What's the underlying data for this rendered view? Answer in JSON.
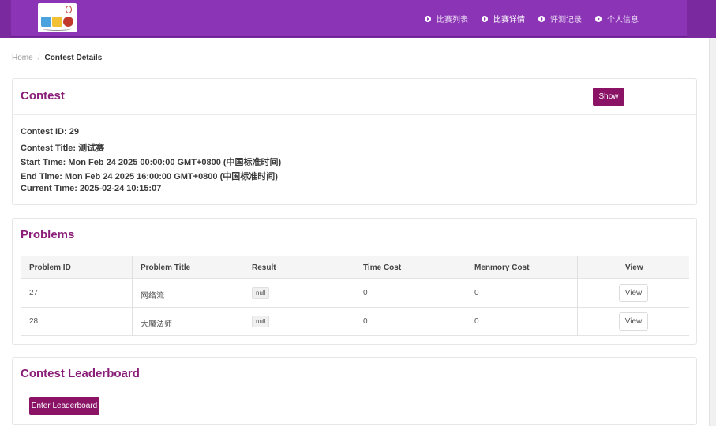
{
  "nav": {
    "items": [
      {
        "label": "比赛列表"
      },
      {
        "label": "比赛详情"
      },
      {
        "label": "评测记录"
      },
      {
        "label": "个人信息"
      }
    ]
  },
  "breadcrumb": {
    "home": "Home",
    "separator": "/",
    "current": "Contest Details"
  },
  "contest": {
    "title": "Contest",
    "show_button": "Show",
    "lines": [
      "Contest ID: 29",
      "Contest Title: 测试赛",
      "Start Time: Mon Feb 24 2025 00:00:00 GMT+0800 (中国标准时间)",
      "End Time: Mon Feb 24 2025 16:00:00 GMT+0800 (中国标准时间)",
      "Current Time: 2025-02-24 10:15:07"
    ]
  },
  "problems": {
    "title": "Problems",
    "columns": [
      "Problem ID",
      "Problem Title",
      "Result",
      "Time Cost",
      "Menmory Cost",
      "View"
    ],
    "rows": [
      {
        "id": "27",
        "title": "网络流",
        "result": "null",
        "time": "0",
        "memory": "0",
        "view": "View"
      },
      {
        "id": "28",
        "title": "大魔法师",
        "result": "null",
        "time": "0",
        "memory": "0",
        "view": "View"
      }
    ]
  },
  "leaderboard": {
    "title": "Contest Leaderboard",
    "button": "Enter Leaderboard"
  },
  "colors": {
    "header": "#8b34b5",
    "accent": "#8a1366",
    "title": "#8a1e78"
  }
}
